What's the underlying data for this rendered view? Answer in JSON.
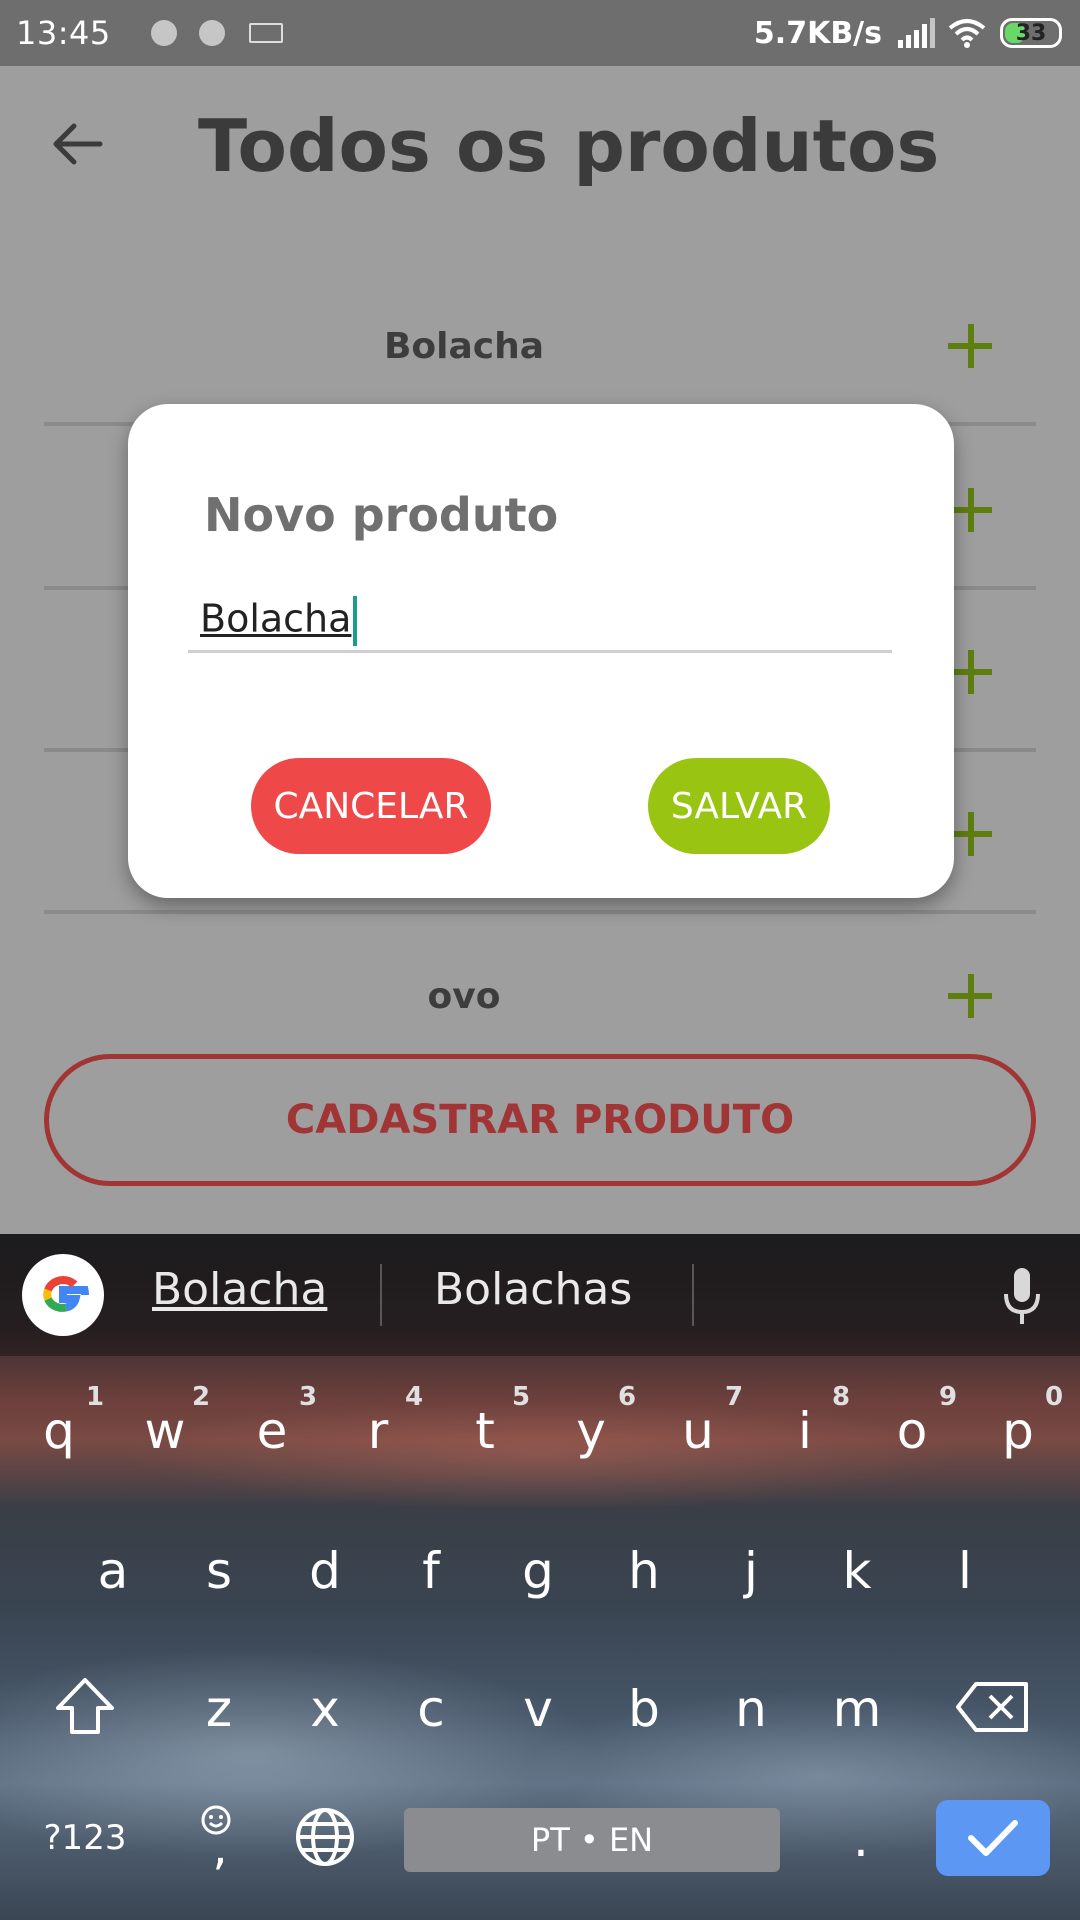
{
  "status_bar": {
    "time": "13:45",
    "speed": "5.7KB/s",
    "battery": "33"
  },
  "header": {
    "title": "Todos os produtos"
  },
  "list": {
    "items": [
      "Bolacha",
      "ovo"
    ]
  },
  "register_button": "CADASTRAR PRODUTO",
  "dialog": {
    "title": "Novo produto",
    "input_value": "Bolacha",
    "cancel_label": "CANCELAR",
    "save_label": "SALVAR"
  },
  "keyboard": {
    "suggestions": [
      "Bolacha",
      "Bolachas"
    ],
    "row1": [
      "q",
      "w",
      "e",
      "r",
      "t",
      "y",
      "u",
      "i",
      "o",
      "p"
    ],
    "row1_hints": [
      "1",
      "2",
      "3",
      "4",
      "5",
      "6",
      "7",
      "8",
      "9",
      "0"
    ],
    "row2": [
      "a",
      "s",
      "d",
      "f",
      "g",
      "h",
      "j",
      "k",
      "l"
    ],
    "row3": [
      "z",
      "x",
      "c",
      "v",
      "b",
      "n",
      "m"
    ],
    "symbols_label": "?123",
    "comma": ",",
    "period": ".",
    "space_label": "PT • EN"
  },
  "colors": {
    "cancel": "#ee4848",
    "save": "#99c412",
    "register_border": "#a13434",
    "plus": "#5f7e10",
    "enter": "#5d97f4"
  }
}
